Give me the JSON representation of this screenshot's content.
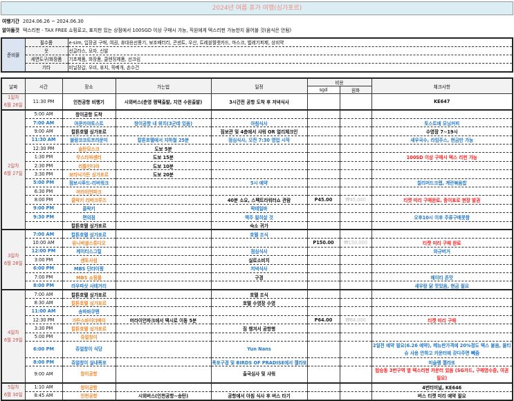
{
  "title": "2024년 여름 휴가 여행(싱가포르)",
  "period": {
    "label": "여행기간",
    "value": "2024.06.26 ~ 2024.06.30"
  },
  "notice": {
    "label": "알아둘것",
    "value": "텍스리펀 - TAX FREE 쇼핑로고, 표지판 있는 상점에서 100SGD 이상 구매시 가능, 직원에게 텍스리펀 가능한지 물어볼 것(음식은 안됨)"
  },
  "prep": {
    "category": "준비물",
    "items": [
      {
        "k": "필수품",
        "v": "e-sim, 입장권 구매, 여권, 휴대용선풍기, 보조배터리, 콘센트, 우산, 트레블월렛카드, 마스크, 벌레기피제, 상비약"
      },
      {
        "k": "옷",
        "v": "선글라스, 모자, 신발"
      },
      {
        "k": "세면도구/화장품",
        "v": "기초제품, 화장품, 클렌징제품, 선크림"
      },
      {
        "k": "기타",
        "v": "비닐장갑, 우비, 휴지, 목베개, 손수건"
      }
    ]
  },
  "headers": {
    "date": "날짜",
    "time": "시간",
    "place": "장소",
    "route": "가는법",
    "schedule": "일정",
    "cost": "비용",
    "sgd": "sgd",
    "krw": "원화",
    "check": "체크사항"
  },
  "days": [
    {
      "day": "1일차",
      "date": "6월 26일",
      "rows": [
        {
          "t": "11:30 PM",
          "p": "인천공항 비행기",
          "r": "시외버스(춘영 평택출발, 지연 수원출발)",
          "s": "3시간전 공항 도착 후 저녁식사",
          "c": "KE647",
          "cl": "kkkkk"
        }
      ]
    },
    {
      "day": "2일차",
      "date": "6월 27일",
      "rows": [
        {
          "t": "5:00 AM",
          "p": "창이공항 도착",
          "cl": "kkkkk"
        },
        {
          "t": "7:00 AM",
          "p": "야쿤카야토스트",
          "r": "창이공항 내 위치(3군데 있음)",
          "s": "아침식사",
          "c": "토스트에 모닝커피",
          "cl": "bbbbb"
        },
        {
          "t": "9:00 AM",
          "p": "칼튼호텔 싱가포르",
          "s": "짐보관 및 4층에서 샤워 OR 얼리체크인",
          "c": "수영장 7~19시",
          "cl": "kkkkk"
        },
        {
          "t": "11:30 AM",
          "p": "블랑코코트프라운미",
          "r": "칼튼호텔에서 지하철 25분",
          "s": "점심식사, 오전 7:30 영업 시작",
          "c": "새우국수, 라임주스, 현금만 가능",
          "cl": "bbbbb"
        },
        {
          "t": "12:30 PM",
          "p": "술탄모스크",
          "r": "도보 5분",
          "cl": "kokkk"
        },
        {
          "t": "1:30 PM",
          "p": "무스타파센터",
          "r": "도보 15분",
          "c": "100SD 이상 구매시 텍스 리펀 가능",
          "cl": "kokkr"
        },
        {
          "t": "2:30 PM",
          "p": "리틀인디아",
          "r": "도보 10분",
          "cl": "kokkk"
        },
        {
          "t": "3:30 PM",
          "p": "보타닉가든 싱가포르",
          "r": "도보 20분",
          "cl": "kokkk"
        },
        {
          "t": "5:00 PM",
          "p": "점보시푸드-리버워크",
          "s": "5시 예약",
          "c": "칠리머드크랩, 계란볶음밥",
          "cl": "bbbbb"
        },
        {
          "t": "6:30 PM",
          "p": "머라이언파크",
          "cl": "kokkk"
        },
        {
          "t": "8:00 PM",
          "p": "클락키 리버크루즈",
          "s": "40분 소요, 스펙트라워터쇼 관람",
          "sgd": "P45.00",
          "krw": "₩45,000",
          "c": "티켓 미리 구매완료, 종이표로 현장 발권",
          "cl": "kokkr"
        },
        {
          "t": "9:00 PM",
          "p": "클락키",
          "s": "락테일바",
          "cl": "bbbbb"
        },
        {
          "t": "9:30 PM",
          "p": "편의점",
          "s": "맥주 필히살 것",
          "c": "오후10시 이후 주류구매못함",
          "cl": "bbbbb"
        },
        {
          "t": "",
          "p": "칼튼호텔 싱가포르",
          "s": "숙소 귀가",
          "cl": "kkkkk"
        }
      ]
    },
    {
      "day": "3일차",
      "date": "6월 28일",
      "rows": [
        {
          "t": "7:00 AM",
          "p": "칼튼호텔 싱가포르",
          "s": "호텔 조식",
          "cl": "bbbbb"
        },
        {
          "t": "10:00 AM",
          "p": "유니버셜스튜디오",
          "sgd": "P150.00",
          "krw": "₩150,000",
          "c": "티켓 미리 구매 완료",
          "cl": "kokkr"
        },
        {
          "t": "12:00 PM",
          "p": "케이티스그릴",
          "s": "점심식사",
          "c": "와규버거",
          "cl": "bbbbb"
        },
        {
          "t": "3:00 PM",
          "p": "센토사섬",
          "s": "실로소비치",
          "cl": "kokkk"
        },
        {
          "t": "6:00 PM",
          "p": "MBS 딘타이펑",
          "s": "저녁식사",
          "cl": "bbbbb"
        },
        {
          "t": "7:00 PM",
          "p": "MBS 쇼핑몰",
          "s": "구경",
          "c": "헤이티 존맛",
          "cl": "kokkb"
        },
        {
          "t": "8:00 PM",
          "p": "라우파삿 사테거리",
          "c": "새우랑 닭 맛있음, 현금 필요",
          "cl": "bbbbb"
        }
      ]
    },
    {
      "day": "4일차",
      "date": "6월 29일",
      "rows": [
        {
          "t": "7:00 AM",
          "p": "칼튼호텔 싱가포르",
          "s": "호텔 조식",
          "cl": "kkkkk"
        },
        {
          "t": "8:30 AM",
          "p": "칼튼호텔 싱가포르",
          "s": "호텔 수영장 수영",
          "cl": "kokkk"
        },
        {
          "t": "11:00 AM",
          "p": "송파바쿠텐",
          "cl": "bbbbb"
        },
        {
          "t": "12:30 PM",
          "p": "가든스바이더베이",
          "r": "머라이언파크에서 택시로 이동 5분",
          "sgd": "P64.00",
          "krw": "₩64,000",
          "c": "티켓 미리 구매",
          "cl": "kokkr"
        },
        {
          "t": "3:30 PM",
          "p": "칼튼호텔 싱가포르",
          "s": "짐 챙겨서 공항행",
          "cl": "kokkk"
        },
        {
          "t": "5:00 PM",
          "p": "쥬얼창이",
          "cl": "kokkk"
        },
        {
          "t": "6:00 PM",
          "p": "쥬얼창이 식당",
          "s": "Yun Nans",
          "c": "2일전 예약 필요(6.26 예약), 메뉴판가격에 20%정도 텍스 붙음, 물티슈 사용 안하고 카운터에 갖다주면 빼줌",
          "cl": "bbbbb",
          "tall": true
        },
        {
          "t": "8:00 PM",
          "p": "쥬얼창이 실내폭포",
          "s": "폭포구경 및 BIRDS OF PRADISE에서 젤라또",
          "c": "미슐랭 젤라또",
          "cl": "bbbbb"
        },
        {
          "t": "9:00 AM",
          "p": "창이공항",
          "s": "출국심사 및 샤워",
          "c": "탑승동 3번구역 옆 텍스리펀 카운터 있음 (SG카드, 구매영수증, 여권 필요)",
          "cl": "kokkr",
          "tall": true
        }
      ]
    },
    {
      "day": "5일차",
      "date": "6월 30일",
      "rows": [
        {
          "t": "1:10 AM",
          "p": "창이공항",
          "c": "4번터미널, KE646",
          "cl": "kokkk"
        },
        {
          "t": "8:45 AM",
          "p": "인천공항",
          "r": "시외버스(인천공항~송탄)",
          "s": "공항에서 아침 식사 후 버스 타기",
          "c": "버스 티켓 미리 예약 필요",
          "cl": "kokkk"
        }
      ]
    }
  ],
  "colors": {
    "blue": "#1f77c9",
    "orange": "#f0862a",
    "red": "#ff1a1a",
    "title": "#f28b82"
  }
}
